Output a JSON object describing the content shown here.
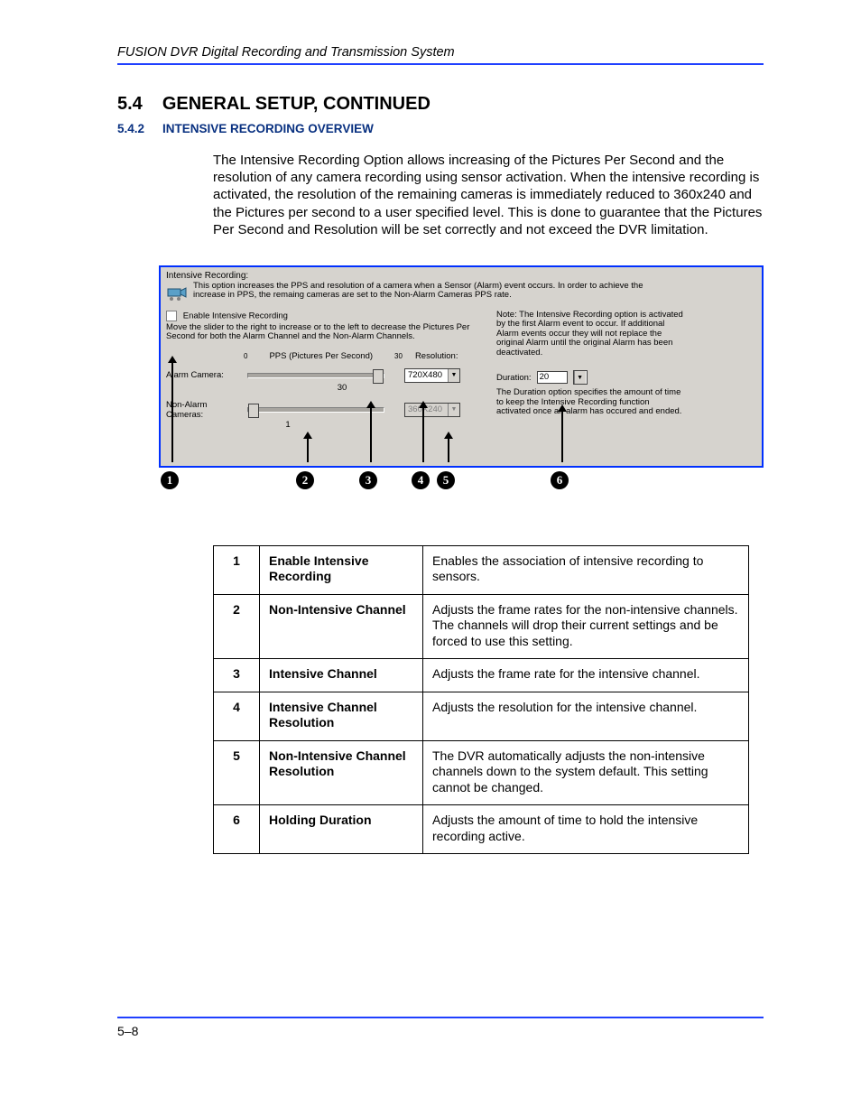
{
  "header": {
    "running": "FUSION DVR Digital Recording and Transmission System"
  },
  "section": {
    "number": "5.4",
    "title": "GENERAL SETUP, CONTINUED",
    "sub_number": "5.4.2",
    "sub_title": "INTENSIVE RECORDING OVERVIEW"
  },
  "paragraph": "The Intensive Recording Option allows increasing of the Pictures Per Second and the resolution of any camera recording using sensor activation. When the intensive recording is activated, the resolution of the remaining cameras is immediately reduced to 360x240 and the Pictures per second to a user specified level. This is done to guarantee that the Pictures Per Second and Resolution will be set correctly and not exceed the DVR limitation.",
  "screenshot": {
    "group_title": "Intensive Recording:",
    "intro": "This option increases the PPS and resolution of a camera when a Sensor (Alarm) event occurs. In order to achieve the increase in PPS, the remaing cameras are set to the Non-Alarm Cameras PPS rate.",
    "enable_label": "Enable Intensive Recording",
    "instruction": "Move the slider to the right to increase or to the left to decrease the Pictures Per Second for both the Alarm Channel and the Non-Alarm Channels.",
    "note": "Note: The Intensive Recording option is activated by the first Alarm event to occur. If additional Alarm events occur they will not replace the original Alarm until the original Alarm has been deactivated.",
    "pps_label": "PPS (Pictures Per Second)",
    "pps_min": "0",
    "pps_max": "30",
    "resolution_label": "Resolution:",
    "alarm_camera_label": "Alarm Camera:",
    "alarm_value": "30",
    "alarm_res": "720X480",
    "nonalarm_label": "Non-Alarm Cameras:",
    "nonalarm_value": "1",
    "nonalarm_res": "360X240",
    "duration_label": "Duration:",
    "duration_value": "20",
    "duration_help": "The Duration option specifies the amount of time to keep the Intensive Recording function activated once an alarm has occured and ended."
  },
  "callouts": [
    "1",
    "2",
    "3",
    "4",
    "5",
    "6"
  ],
  "table": [
    {
      "n": "1",
      "name": "Enable Intensive Recording",
      "desc": "Enables the association of intensive recording to sensors."
    },
    {
      "n": "2",
      "name": "Non-Intensive Channel",
      "desc": "Adjusts the frame rates for the non-intensive channels. The channels will drop their current settings and be forced to use this setting."
    },
    {
      "n": "3",
      "name": "Intensive Channel",
      "desc": "Adjusts the frame rate for the intensive channel."
    },
    {
      "n": "4",
      "name": "Intensive Channel Resolution",
      "desc": "Adjusts the resolution for the intensive channel."
    },
    {
      "n": "5",
      "name": "Non-Intensive Channel Resolution",
      "desc": "The DVR automatically adjusts the non-intensive channels down to the system default. This setting cannot be changed."
    },
    {
      "n": "6",
      "name": "Holding Duration",
      "desc": "Adjusts the amount of time to hold the intensive recording active."
    }
  ],
  "footer": {
    "page": "5–8"
  }
}
